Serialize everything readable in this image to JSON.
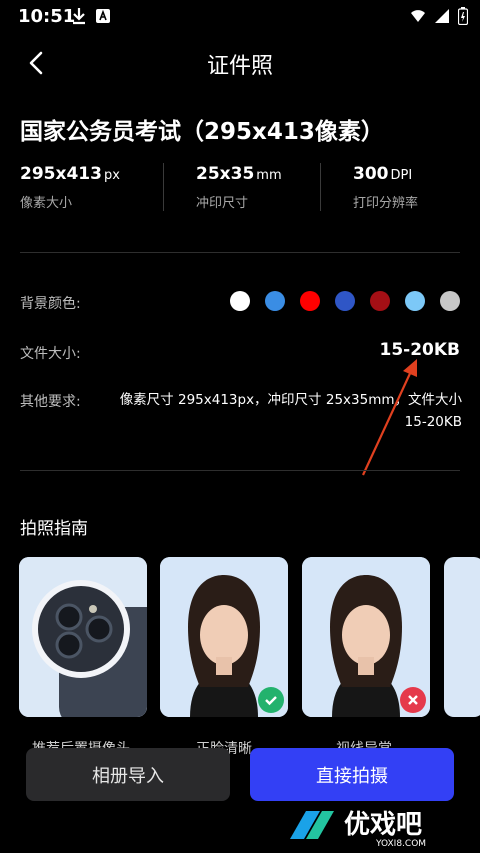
{
  "status_bar": {
    "time": "10:51"
  },
  "header": {
    "title": "证件照"
  },
  "spec": {
    "title": "国家公务员考试（295x413像素）",
    "stats": [
      {
        "value": "295x413",
        "unit": "px",
        "label": "像素大小"
      },
      {
        "value": "25x35",
        "unit": "mm",
        "label": "冲印尺寸"
      },
      {
        "value": "300",
        "unit": "DPI",
        "label": "打印分辨率"
      }
    ]
  },
  "details": {
    "bg_label": "背景颜色:",
    "bg_colors": [
      "#ffffff",
      "#3a8de4",
      "#ff0000",
      "#2f56c6",
      "#a40f15",
      "#7cc8f7",
      "#c8c8c8"
    ],
    "size_label": "文件大小:",
    "size_value": "15-20KB",
    "other_label": "其他要求:",
    "other_value": "像素尺寸 295x413px，冲印尺寸 25x35mm，文件大小 15-20KB"
  },
  "guide": {
    "title": "拍照指南",
    "cards": [
      {
        "label": "推荐后置摄像头"
      },
      {
        "label": "正脸清晰",
        "status": "ok"
      },
      {
        "label": "视线异常",
        "status": "bad"
      }
    ]
  },
  "buttons": {
    "album": "相册导入",
    "shoot": "直接拍摄"
  },
  "colors": {
    "accent": "#3340f5",
    "secondary_btn": "#2a2a2c",
    "arrow": "#e0401f"
  },
  "watermark": {
    "brand": "优戏吧",
    "site": "YOXI8.COM"
  }
}
